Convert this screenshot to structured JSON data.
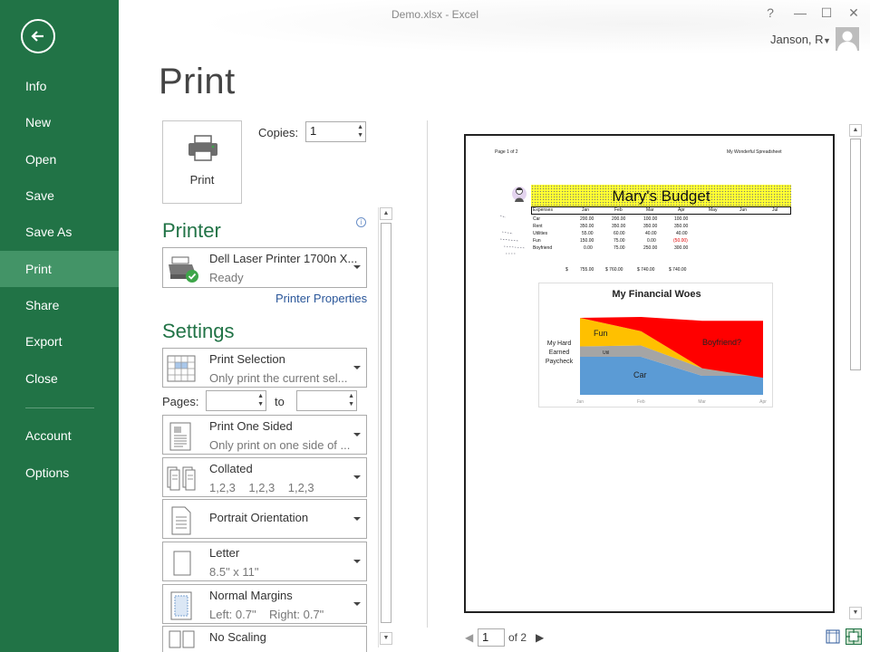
{
  "window": {
    "title": "Demo.xlsx - Excel",
    "help": "?",
    "minimize": "—",
    "restore": "☐",
    "close": "✕",
    "user": "Janson, R"
  },
  "nav": {
    "items": [
      {
        "label": "Info"
      },
      {
        "label": "New"
      },
      {
        "label": "Open"
      },
      {
        "label": "Save"
      },
      {
        "label": "Save As"
      },
      {
        "label": "Print"
      },
      {
        "label": "Share"
      },
      {
        "label": "Export"
      },
      {
        "label": "Close"
      },
      {
        "label": "Account"
      },
      {
        "label": "Options"
      }
    ],
    "active": "Print"
  },
  "page": {
    "title": "Print"
  },
  "print_button": {
    "label": "Print"
  },
  "copies": {
    "label": "Copies:",
    "value": "1"
  },
  "printer": {
    "heading": "Printer",
    "name": "Dell Laser Printer 1700n X...",
    "status": "Ready",
    "properties_link": "Printer Properties"
  },
  "settings": {
    "heading": "Settings",
    "print_what": {
      "title": "Print Selection",
      "subtitle": "Only print the current sel..."
    },
    "pages": {
      "label": "Pages:",
      "to_label": "to",
      "from": "",
      "to": ""
    },
    "sides": {
      "title": "Print One Sided",
      "subtitle": "Only print on one side of ..."
    },
    "collation": {
      "title": "Collated",
      "subtitle": "1,2,3    1,2,3    1,2,3"
    },
    "orientation": {
      "title": "Portrait Orientation"
    },
    "paper": {
      "title": "Letter",
      "subtitle": "8.5\" x 11\""
    },
    "margins": {
      "title": "Normal Margins",
      "subtitle": "Left: 0.7\"    Right: 0.7\""
    },
    "scaling": {
      "title": "No Scaling"
    }
  },
  "preview": {
    "header_left": "Page 1 of 2",
    "header_right": "My Wonderful Spreadsheet",
    "banner_title": "Mary's Budget",
    "table": {
      "headers": [
        "Expenses",
        "Jan",
        "Feb",
        "Mar",
        "Apr",
        "May",
        "Jun",
        "Jul"
      ],
      "rows": [
        [
          "Car",
          "200.00",
          "200.00",
          "100.00",
          "100.00"
        ],
        [
          "Rent",
          "350.00",
          "350.00",
          "350.00",
          "350.00"
        ],
        [
          "Utilities",
          "55.00",
          "60.00",
          "40.00",
          "40.00"
        ],
        [
          "Fun",
          "150.00",
          "75.00",
          "0.00",
          "(50.00)"
        ],
        [
          "Boyfriend",
          "0.00",
          "75.00",
          "250.00",
          "300.00"
        ]
      ],
      "totals": [
        "$",
        "755.00",
        "$ 760.00",
        "$ 740.00",
        "$ 740.00"
      ]
    }
  },
  "chart_data": {
    "type": "area",
    "title": "My Financial Woes",
    "categories": [
      "Jan",
      "Feb",
      "Mar",
      "Apr"
    ],
    "series": [
      {
        "name": "Car",
        "values": [
          200,
          200,
          100,
          100
        ]
      },
      {
        "name": "Util",
        "values": [
          55,
          60,
          40,
          40
        ]
      },
      {
        "name": "Fun",
        "values": [
          150,
          75,
          0,
          -50
        ]
      },
      {
        "name": "Boyfriend?",
        "values": [
          0,
          75,
          250,
          300
        ]
      }
    ],
    "ylabel": "My Hard Earned Paycheck",
    "colors": {
      "Car": "#5b9bd5",
      "Util": "#a5a5a5",
      "Fun": "#ffc000",
      "Boyfriend?": "#ff0000"
    }
  },
  "pager": {
    "current": "1",
    "of_label": "of 2"
  },
  "colors": {
    "brand": "#217346",
    "nav_active": "#439467",
    "link": "#2b579a"
  }
}
